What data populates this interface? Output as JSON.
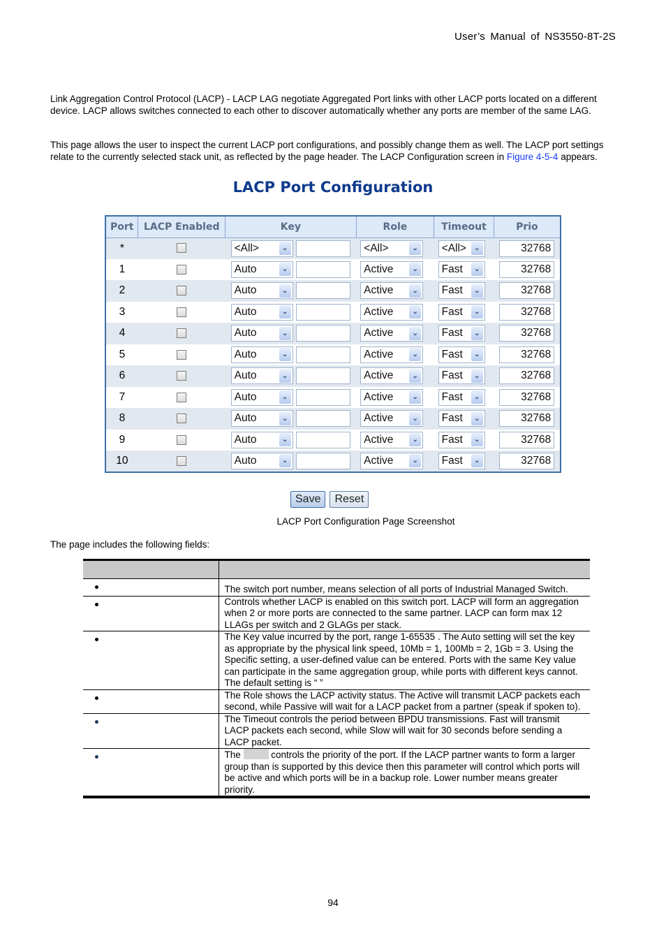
{
  "header": {
    "running_title": "User’s  Manual  of  NS3550-8T-2S"
  },
  "intro": {
    "para1": "Link Aggregation Control Protocol (LACP) - LACP LAG negotiate Aggregated Port links with other LACP ports located on a different device. LACP allows switches connected to each other to discover automatically whether any ports are member of the same LAG.",
    "para2_before_link": "This page allows the user to inspect the current LACP port configurations, and possibly change them as well. The LACP port settings relate to the currently selected stack unit, as reflected by the page header. The LACP Configuration screen in ",
    "para2_link": "Figure 4-5-4",
    "para2_after_link": " appears."
  },
  "config": {
    "title": "LACP Port Configuration",
    "columns": [
      "Port",
      "LACP Enabled",
      "Key",
      "Role",
      "Timeout",
      "Prio"
    ],
    "rows": [
      {
        "port": "*",
        "lacp_enabled": false,
        "key_mode": "<All>",
        "key_value": "",
        "role": "<All>",
        "timeout": "<All>",
        "prio": "32768"
      },
      {
        "port": "1",
        "lacp_enabled": false,
        "key_mode": "Auto",
        "key_value": "",
        "role": "Active",
        "timeout": "Fast",
        "prio": "32768"
      },
      {
        "port": "2",
        "lacp_enabled": false,
        "key_mode": "Auto",
        "key_value": "",
        "role": "Active",
        "timeout": "Fast",
        "prio": "32768"
      },
      {
        "port": "3",
        "lacp_enabled": false,
        "key_mode": "Auto",
        "key_value": "",
        "role": "Active",
        "timeout": "Fast",
        "prio": "32768"
      },
      {
        "port": "4",
        "lacp_enabled": false,
        "key_mode": "Auto",
        "key_value": "",
        "role": "Active",
        "timeout": "Fast",
        "prio": "32768"
      },
      {
        "port": "5",
        "lacp_enabled": false,
        "key_mode": "Auto",
        "key_value": "",
        "role": "Active",
        "timeout": "Fast",
        "prio": "32768"
      },
      {
        "port": "6",
        "lacp_enabled": false,
        "key_mode": "Auto",
        "key_value": "",
        "role": "Active",
        "timeout": "Fast",
        "prio": "32768"
      },
      {
        "port": "7",
        "lacp_enabled": false,
        "key_mode": "Auto",
        "key_value": "",
        "role": "Active",
        "timeout": "Fast",
        "prio": "32768"
      },
      {
        "port": "8",
        "lacp_enabled": false,
        "key_mode": "Auto",
        "key_value": "",
        "role": "Active",
        "timeout": "Fast",
        "prio": "32768"
      },
      {
        "port": "9",
        "lacp_enabled": false,
        "key_mode": "Auto",
        "key_value": "",
        "role": "Active",
        "timeout": "Fast",
        "prio": "32768"
      },
      {
        "port": "10",
        "lacp_enabled": false,
        "key_mode": "Auto",
        "key_value": "",
        "role": "Active",
        "timeout": "Fast",
        "prio": "32768"
      }
    ],
    "buttons": {
      "save": "Save",
      "reset": "Reset"
    },
    "dropdown_icon": "chevron-down-icon"
  },
  "caption": "LACP Port Configuration Page Screenshot",
  "fields_intro": "The page includes the following fields:",
  "fields": {
    "header": [
      "",
      ""
    ],
    "rows": [
      {
        "name": "",
        "bullet_color": "#000000",
        "desc_part1": "The switch port number,    means selection of all ports of Industrial Managed Switch."
      },
      {
        "name": "",
        "bullet_color": "#000000",
        "desc_part1": "Controls whether LACP is enabled on this switch port. LACP will form an aggregation when 2 or more ports are connected to the same partner. LACP can form max 12 LLAGs per switch and 2 GLAGs per stack."
      },
      {
        "name": "",
        "bullet_color": "#000000",
        "desc_part1": "The Key value incurred by the port, range 1-65535 . The Auto setting will set the key as appropriate by the physical link speed, 10Mb = 1, 100Mb = 2, 1Gb = 3. Using the Specific setting, a user-defined value can be entered. Ports with the same Key value can participate in the same aggregation group, while ports with different keys cannot.",
        "desc_part2": "The default setting is “        ”"
      },
      {
        "name": "",
        "bullet_color": "#000000",
        "desc_part1": "The Role shows the LACP activity status. The Active will transmit LACP packets each second, while Passive will wait for a LACP packet from a partner (speak if spoken to)."
      },
      {
        "name": "",
        "bullet_color": "#1f3a5c",
        "desc_part1": "The Timeout controls the period between BPDU transmissions. Fast will transmit LACP packets each second, while Slow will wait for 30 seconds before sending a LACP packet."
      },
      {
        "name": "",
        "bullet_color": "#1f3a5c",
        "desc_part1": "The",
        "desc_part2": " controls the priority of the port. If the LACP partner wants to form a larger group than is supported by this device then this parameter will control which ports will be active and which ports will be in a backup role. Lower number means greater priority."
      }
    ]
  },
  "page_number": "94"
}
